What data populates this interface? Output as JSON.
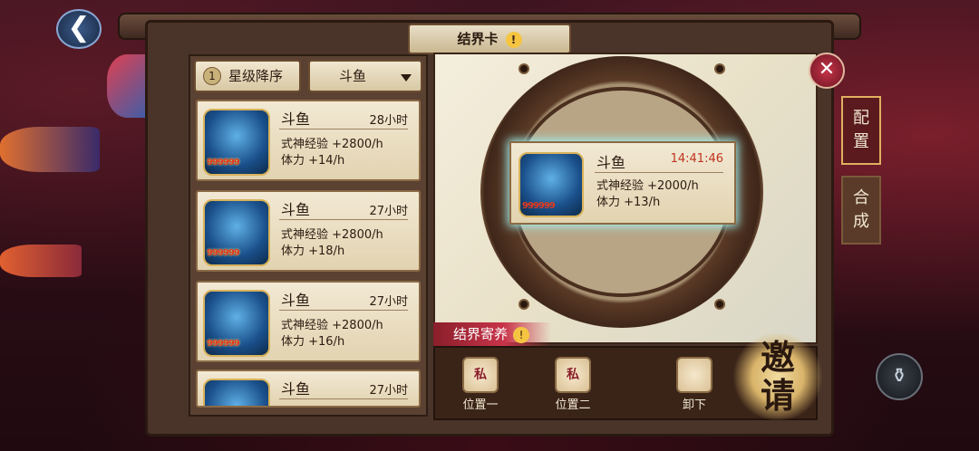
{
  "window": {
    "title": "结界卡",
    "title_warn": "!"
  },
  "nav": {
    "back_icon": "back-arrow-icon",
    "back_glyph": "❮"
  },
  "sort": {
    "icon_label": "1",
    "label": "星级降序"
  },
  "filter": {
    "label": "斗鱼"
  },
  "cards": [
    {
      "name": "斗鱼",
      "duration": "28小时",
      "exp": "式神经验 +2800/h",
      "stamina": "体力 +14/h",
      "stars": "999999"
    },
    {
      "name": "斗鱼",
      "duration": "27小时",
      "exp": "式神经验 +2800/h",
      "stamina": "体力 +18/h",
      "stars": "999999"
    },
    {
      "name": "斗鱼",
      "duration": "27小时",
      "exp": "式神经验 +2800/h",
      "stamina": "体力 +16/h",
      "stars": "999999"
    },
    {
      "name": "斗鱼",
      "duration": "27小时",
      "exp": "",
      "stamina": "",
      "stars": ""
    }
  ],
  "active_card": {
    "name": "斗鱼",
    "timer": "14:41:46",
    "exp": "式神经验 +2000/h",
    "stamina": "体力 +13/h",
    "stars": "999999"
  },
  "foster": {
    "label": "结界寄养",
    "warn": "!"
  },
  "positions": [
    {
      "lamp": "私",
      "label": "位置一"
    },
    {
      "lamp": "私",
      "label": "位置二"
    },
    {
      "lamp": "",
      "label": "卸下"
    }
  ],
  "invite": {
    "line1": "邀",
    "line2": "请"
  },
  "close": {
    "glyph": "✕"
  },
  "tabs": [
    {
      "line1": "配",
      "line2": "置"
    },
    {
      "line1": "合",
      "line2": "成"
    }
  ],
  "sake": {
    "glyph": "⚱"
  },
  "colors": {
    "accent_red": "#8a1e2a",
    "timer_red": "#c0321e",
    "panel_brown": "#4a3328",
    "parchment": "#f2e9d4"
  }
}
